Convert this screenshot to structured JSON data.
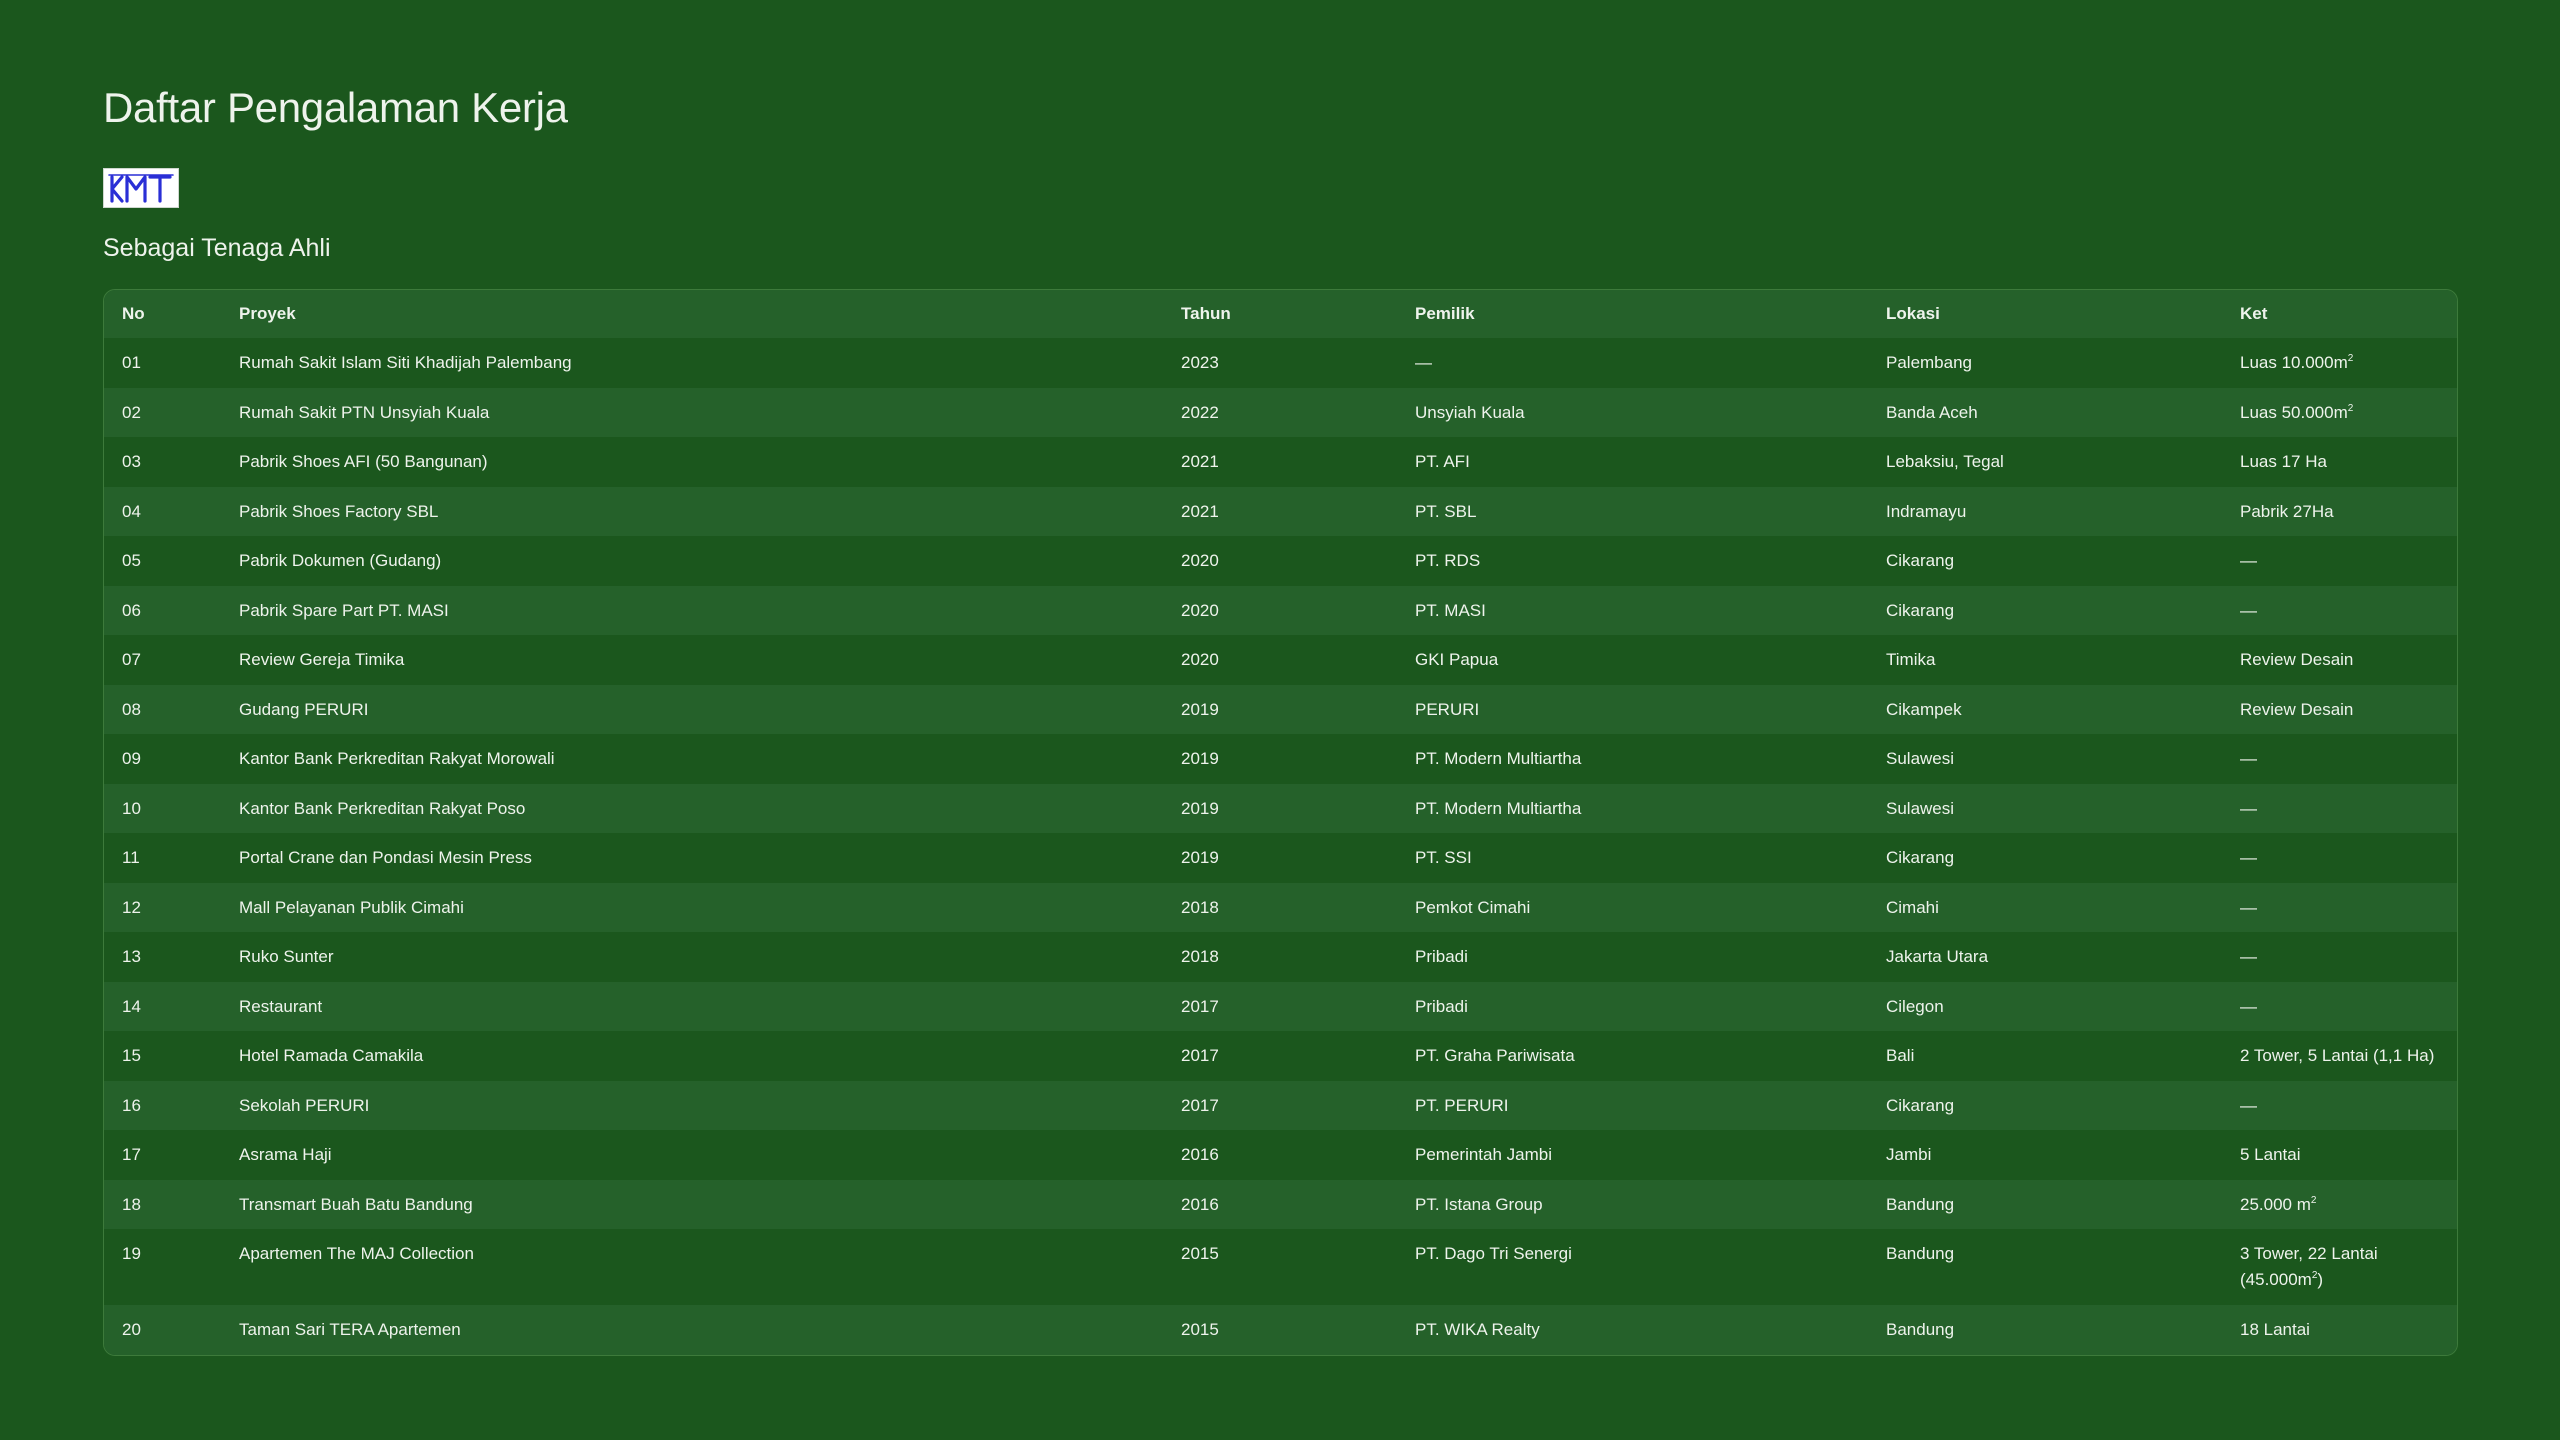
{
  "page": {
    "title": "Daftar Pengalaman Kerja",
    "logo_text": "KMT",
    "subtitle": "Sebagai Tenaga Ahli"
  },
  "colors": {
    "background": "#1b571d",
    "row_alt": "#25612a",
    "text": "#eef3ec",
    "logo_blue": "#2a2fd6"
  },
  "table": {
    "headers": {
      "no": "No",
      "proyek": "Proyek",
      "tahun": "Tahun",
      "pemilik": "Pemilik",
      "lokasi": "Lokasi",
      "ket": "Ket"
    },
    "rows": [
      {
        "no": "01",
        "proyek": "Rumah Sakit Islam Siti Khadijah Palembang",
        "tahun": "2023",
        "pemilik": "—",
        "lokasi": "Palembang",
        "ket": "Luas 10.000m",
        "ket_sup": "2"
      },
      {
        "no": "02",
        "proyek": "Rumah Sakit PTN Unsyiah Kuala",
        "tahun": "2022",
        "pemilik": "Unsyiah Kuala",
        "lokasi": "Banda Aceh",
        "ket": "Luas 50.000m",
        "ket_sup": "2"
      },
      {
        "no": "03",
        "proyek": "Pabrik Shoes AFI (50 Bangunan)",
        "tahun": "2021",
        "pemilik": "PT. AFI",
        "lokasi": "Lebaksiu, Tegal",
        "ket": "Luas 17 Ha"
      },
      {
        "no": "04",
        "proyek": "Pabrik Shoes Factory SBL",
        "tahun": "2021",
        "pemilik": "PT. SBL",
        "lokasi": "Indramayu",
        "ket": "Pabrik 27Ha"
      },
      {
        "no": "05",
        "proyek": "Pabrik Dokumen (Gudang)",
        "tahun": "2020",
        "pemilik": "PT. RDS",
        "lokasi": "Cikarang",
        "ket": "—"
      },
      {
        "no": "06",
        "proyek": "Pabrik Spare Part PT. MASI",
        "tahun": "2020",
        "pemilik": "PT. MASI",
        "lokasi": "Cikarang",
        "ket": "—"
      },
      {
        "no": "07",
        "proyek": "Review Gereja Timika",
        "tahun": "2020",
        "pemilik": "GKI Papua",
        "lokasi": "Timika",
        "ket": "Review Desain"
      },
      {
        "no": "08",
        "proyek": "Gudang PERURI",
        "tahun": "2019",
        "pemilik": "PERURI",
        "lokasi": "Cikampek",
        "ket": "Review Desain"
      },
      {
        "no": "09",
        "proyek": "Kantor Bank Perkreditan Rakyat Morowali",
        "tahun": "2019",
        "pemilik": "PT. Modern Multiartha",
        "lokasi": "Sulawesi",
        "ket": "—"
      },
      {
        "no": "10",
        "proyek": "Kantor Bank Perkreditan Rakyat Poso",
        "tahun": "2019",
        "pemilik": "PT. Modern Multiartha",
        "lokasi": "Sulawesi",
        "ket": "—"
      },
      {
        "no": "11",
        "proyek": "Portal Crane dan Pondasi Mesin Press",
        "tahun": "2019",
        "pemilik": "PT. SSI",
        "lokasi": "Cikarang",
        "ket": "—"
      },
      {
        "no": "12",
        "proyek": "Mall Pelayanan Publik Cimahi",
        "tahun": "2018",
        "pemilik": "Pemkot Cimahi",
        "lokasi": "Cimahi",
        "ket": "—"
      },
      {
        "no": "13",
        "proyek": "Ruko Sunter",
        "tahun": "2018",
        "pemilik": "Pribadi",
        "lokasi": "Jakarta Utara",
        "ket": "—"
      },
      {
        "no": "14",
        "proyek": "Restaurant",
        "tahun": "2017",
        "pemilik": "Pribadi",
        "lokasi": "Cilegon",
        "ket": "—"
      },
      {
        "no": "15",
        "proyek": "Hotel Ramada Camakila",
        "tahun": "2017",
        "pemilik": "PT. Graha Pariwisata",
        "lokasi": "Bali",
        "ket": "2 Tower, 5 Lantai (1,1 Ha)"
      },
      {
        "no": "16",
        "proyek": "Sekolah PERURI",
        "tahun": "2017",
        "pemilik": "PT. PERURI",
        "lokasi": "Cikarang",
        "ket": "—"
      },
      {
        "no": "17",
        "proyek": "Asrama Haji",
        "tahun": "2016",
        "pemilik": "Pemerintah Jambi",
        "lokasi": "Jambi",
        "ket": "5 Lantai"
      },
      {
        "no": "18",
        "proyek": "Transmart Buah Batu Bandung",
        "tahun": "2016",
        "pemilik": "PT. Istana Group",
        "lokasi": "Bandung",
        "ket": "25.000 m",
        "ket_sup": "2"
      },
      {
        "no": "19",
        "proyek": "Apartemen The MAJ Collection",
        "tahun": "2015",
        "pemilik": "PT. Dago Tri Senergi",
        "lokasi": "Bandung",
        "ket": "3 Tower, 22 Lantai (45.000m",
        "ket_sup": "2",
        "ket_after": ")",
        "tall": true
      },
      {
        "no": "20",
        "proyek": "Taman Sari TERA Apartemen",
        "tahun": "2015",
        "pemilik": "PT. WIKA Realty",
        "lokasi": "Bandung",
        "ket": "18 Lantai"
      }
    ]
  }
}
